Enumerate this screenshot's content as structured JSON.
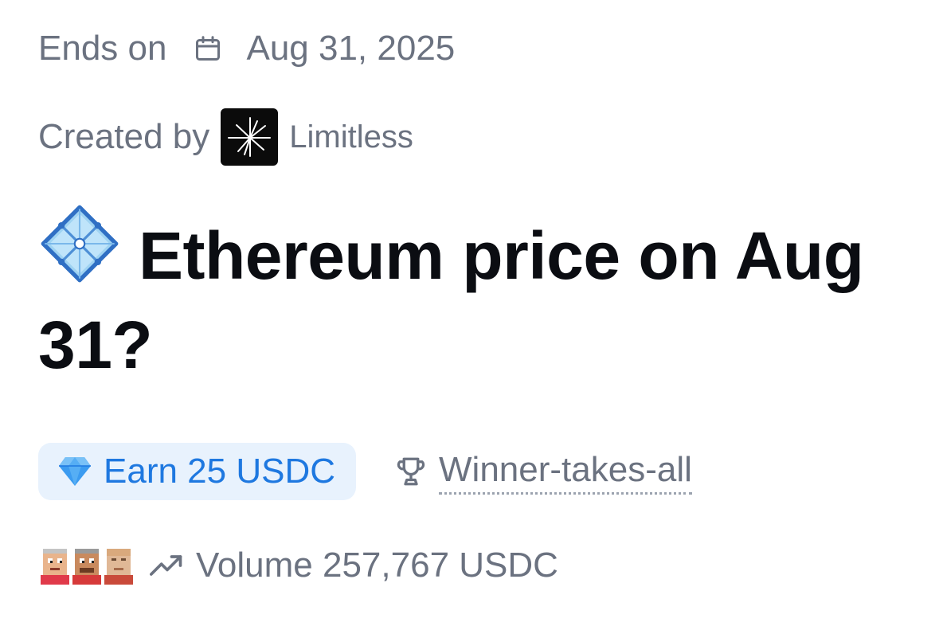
{
  "ends": {
    "label": "Ends on",
    "icon": "calendar-icon",
    "date": "Aug 31, 2025"
  },
  "creator": {
    "label": "Created by",
    "logo_icon": "limitless-logo",
    "name": "Limitless"
  },
  "title": {
    "icon": "diamond-gem-icon",
    "text": "Ethereum price on Aug 31?"
  },
  "reward": {
    "icon": "gem-icon",
    "label": "Earn 25 USDC",
    "accent": "#1e78e0",
    "background": "#e8f2fd"
  },
  "format": {
    "icon": "trophy-icon",
    "label": "Winner-takes-all"
  },
  "volume": {
    "avatars": [
      "pixel-avatar-1",
      "pixel-avatar-2",
      "pixel-avatar-3"
    ],
    "icon": "trending-up-icon",
    "label": "Volume 257,767 USDC"
  },
  "colors": {
    "muted_text": "#6b7280",
    "title_text": "#0b0d12"
  }
}
